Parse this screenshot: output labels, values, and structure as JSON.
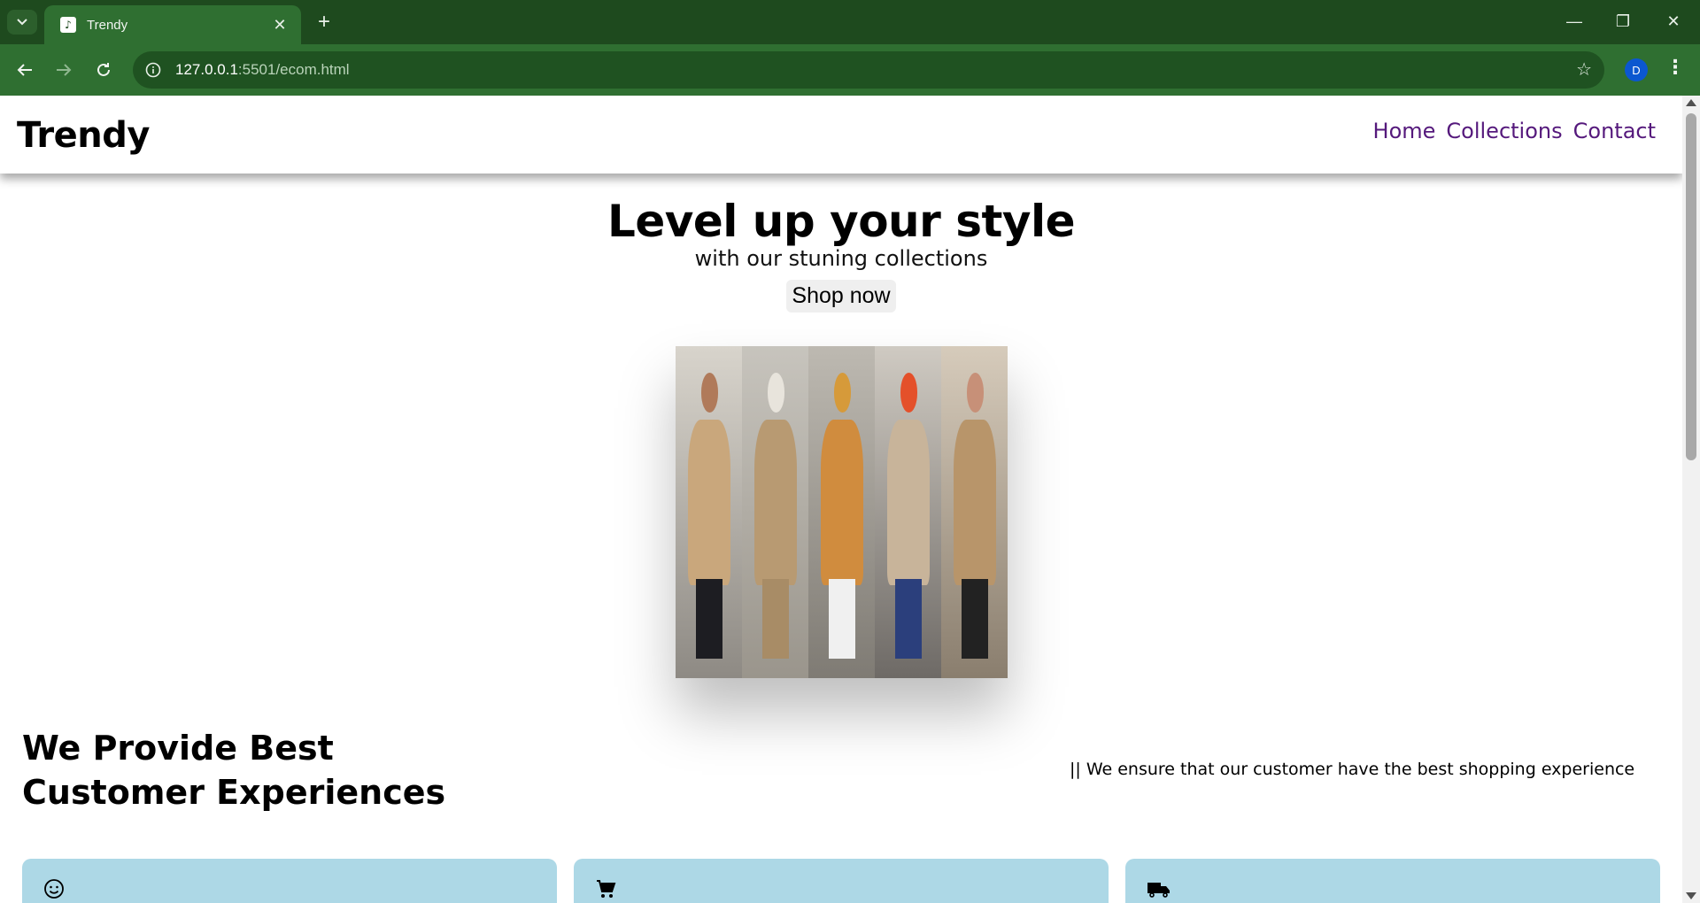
{
  "browser": {
    "tab_title": "Trendy",
    "url_host": "127.0.0.1",
    "url_rest": ":5501/ecom.html",
    "profile_initial": "D",
    "theme_color": "#2f6f31"
  },
  "site": {
    "logo": "Trendy",
    "nav": [
      "Home",
      "Collections",
      "Contact"
    ],
    "nav_color": "#55197c"
  },
  "hero": {
    "title": "Level up your style",
    "subtitle": "with our stuning collections",
    "cta": "Shop now",
    "image_alt": "street style photo collage"
  },
  "features": {
    "title": "We Provide Best Customer Experiences",
    "tagline": "|| We ensure that our customer have the best shopping experience",
    "cards": [
      {
        "icon": "smiley-icon"
      },
      {
        "icon": "cart-icon"
      },
      {
        "icon": "delivery-truck-icon"
      }
    ],
    "card_color": "#add8e6"
  }
}
